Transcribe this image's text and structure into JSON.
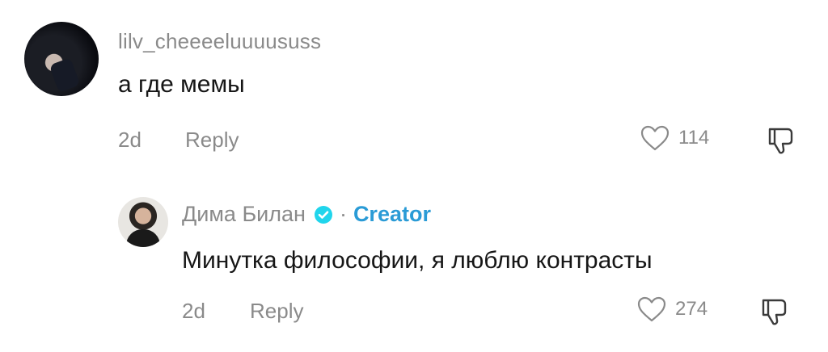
{
  "comments": [
    {
      "username": "lilv_cheeeeluuuususs",
      "text": "а где мемы",
      "time": "2d",
      "reply_label": "Reply",
      "likes": "114"
    },
    {
      "username": "Дима Билан",
      "creator_label": "Creator",
      "separator": "·",
      "text": "Минутка философии, я люблю контрасты",
      "time": "2d",
      "reply_label": "Reply",
      "likes": "274"
    }
  ],
  "icons": {
    "like": "heart-outline-icon",
    "dislike": "thumbs-down-icon",
    "verified": "verified-badge-icon"
  },
  "colors": {
    "muted": "#8a8a8a",
    "text": "#161616",
    "creator_accent": "#2a9bd6"
  }
}
